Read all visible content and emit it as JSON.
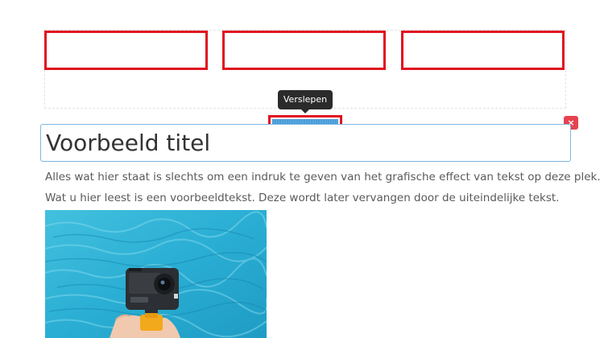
{
  "editor": {
    "tooltip_label": "Verslepen",
    "close_label": "×",
    "title_value": "Voorbeeld titel",
    "paragraph_lines": [
      "Alles wat hier staat is slechts om een indruk te geven van het grafische effect van tekst op deze plek.",
      "Wat u hier leest is een voorbeeldtekst. Deze wordt later vervangen door de uiteindelijke tekst."
    ]
  },
  "image": {
    "icon": "action-camera-in-pool-photo",
    "colors": {
      "water": "#2fb0d4",
      "camera": "#2c2f33",
      "mount": "#f2a91b"
    }
  },
  "colors": {
    "highlight_border": "#e0121f",
    "handle_fill": "#4a9ed8",
    "close_button": "#e5434f",
    "field_border": "#7fb6e0"
  }
}
